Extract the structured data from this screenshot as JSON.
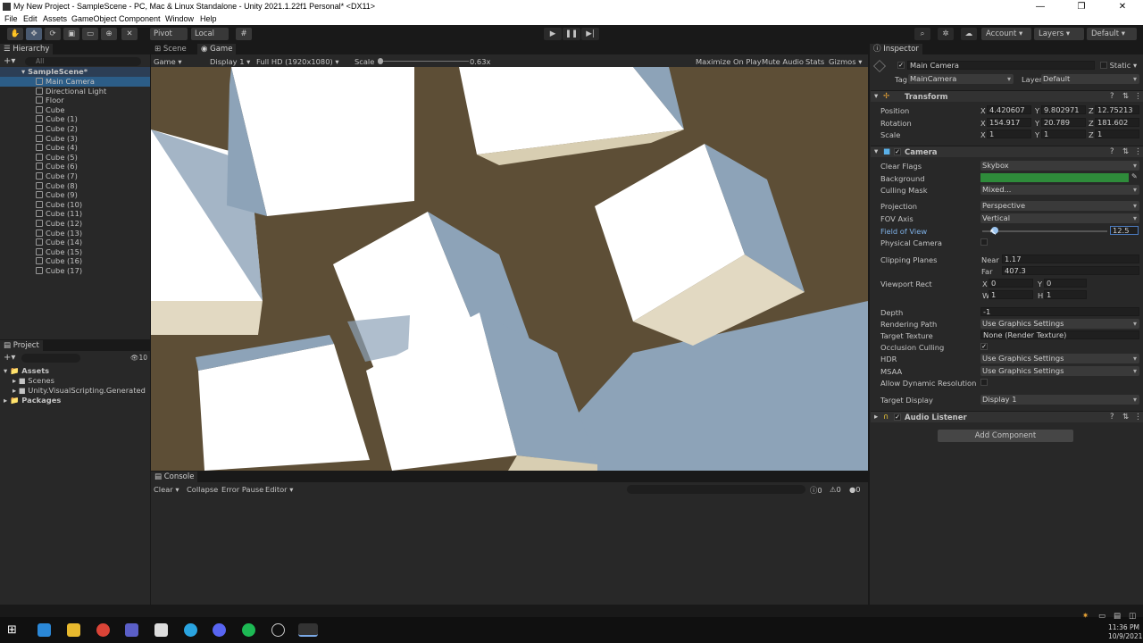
{
  "window": {
    "title": "My New Project - SampleScene - PC, Mac & Linux Standalone - Unity 2021.1.22f1 Personal* <DX11>",
    "controls": [
      "—",
      "❐",
      "✕"
    ]
  },
  "menu": [
    "File",
    "Edit",
    "Assets",
    "GameObject",
    "Component",
    "Window",
    "Help"
  ],
  "toolbar": {
    "pivot_label": "Pivot",
    "local_label": "Local",
    "account_label": "Account",
    "layers_label": "Layers",
    "layout_label": "Default"
  },
  "hierarchy": {
    "tab": "Hierarchy",
    "search_placeholder": "All",
    "scene": "SampleScene*",
    "items": [
      "Main Camera",
      "Directional Light",
      "Floor",
      "Cube",
      "Cube (1)",
      "Cube (2)",
      "Cube (3)",
      "Cube (4)",
      "Cube (5)",
      "Cube (6)",
      "Cube (7)",
      "Cube (8)",
      "Cube (9)",
      "Cube (10)",
      "Cube (11)",
      "Cube (12)",
      "Cube (13)",
      "Cube (14)",
      "Cube (15)",
      "Cube (16)",
      "Cube (17)"
    ]
  },
  "project": {
    "tab": "Project",
    "count": "10",
    "tree": [
      "Assets",
      "Scenes",
      "Unity.VisualScripting.Generated",
      "Packages"
    ]
  },
  "game_view": {
    "tabs": [
      "Scene",
      "Game"
    ],
    "mode": "Game",
    "display": "Display 1",
    "resolution": "Full HD (1920x1080)",
    "scale_label": "Scale",
    "scale_value": "0.63x",
    "options": [
      "Maximize On Play",
      "Mute Audio",
      "Stats",
      "Gizmos"
    ]
  },
  "console": {
    "tab": "Console",
    "clear": "Clear",
    "collapse": "Collapse",
    "error_pause": "Error Pause",
    "editor": "Editor",
    "counts": [
      "0",
      "0",
      "0"
    ]
  },
  "inspector": {
    "tab": "Inspector",
    "object_name": "Main Camera",
    "static_label": "Static",
    "tag_label": "Tag",
    "tag_value": "MainCamera",
    "layer_label": "Layer",
    "layer_value": "Default",
    "transform": {
      "title": "Transform",
      "rows": [
        {
          "label": "Position",
          "x": "4.420607",
          "y": "9.802971",
          "z": "12.75213"
        },
        {
          "label": "Rotation",
          "x": "154.917",
          "y": "20.789",
          "z": "181.602"
        },
        {
          "label": "Scale",
          "x": "1",
          "y": "1",
          "z": "1"
        }
      ]
    },
    "camera": {
      "title": "Camera",
      "clear_flags_label": "Clear Flags",
      "clear_flags": "Skybox",
      "background_label": "Background",
      "background_color": "#2e8b3a",
      "culling_mask_label": "Culling Mask",
      "culling_mask": "Mixed...",
      "projection_label": "Projection",
      "projection": "Perspective",
      "fov_axis_label": "FOV Axis",
      "fov_axis": "Vertical",
      "fov_label": "Field of View",
      "fov_value": "12.5",
      "fov_fraction": 0.07,
      "physical_label": "Physical Camera",
      "clipping_label": "Clipping Planes",
      "near_label": "Near",
      "near": "1.17",
      "far_label": "Far",
      "far": "407.3",
      "viewport_label": "Viewport Rect",
      "vx": "0",
      "vy": "0",
      "vw": "1",
      "vh": "1",
      "depth_label": "Depth",
      "depth": "-1",
      "rendering_path_label": "Rendering Path",
      "rendering_path": "Use Graphics Settings",
      "target_texture_label": "Target Texture",
      "target_texture": "None (Render Texture)",
      "occlusion_label": "Occlusion Culling",
      "hdr_label": "HDR",
      "hdr": "Use Graphics Settings",
      "msaa_label": "MSAA",
      "msaa": "Use Graphics Settings",
      "dynres_label": "Allow Dynamic Resolution",
      "target_display_label": "Target Display",
      "target_display": "Display 1"
    },
    "audio_listener": "Audio Listener",
    "add_component": "Add Component"
  },
  "taskbar": {
    "time": "11:36 PM",
    "date": "10/9/2021"
  }
}
